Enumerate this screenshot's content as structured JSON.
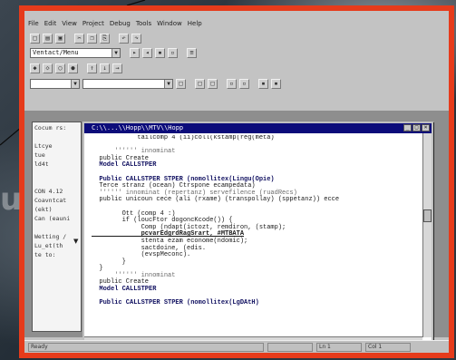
{
  "menu": [
    "File",
    "Edit",
    "View",
    "Project",
    "Debug",
    "Tools",
    "Window",
    "Help"
  ],
  "toolbar_rows": [
    [
      "□",
      "▤",
      "▣",
      "│",
      "✂",
      "❐",
      "⎘",
      "│",
      "↶",
      "↷"
    ],
    [
      "▸",
      "◂",
      "▪",
      "▫",
      "│",
      "≡"
    ],
    [
      "◆",
      "◇",
      "○",
      "●",
      "│",
      "↑",
      "↓",
      "→"
    ],
    [
      "□",
      "│",
      "□",
      "□",
      "│",
      "▫",
      "▫",
      "│",
      "▪",
      "▪"
    ]
  ],
  "combo_value": "Ventact/Menu",
  "editor": {
    "title": "C:\\\\...\\\\Hopp\\\\MTV\\\\Hopp",
    "lines": [
      {
        "t": "            tailcomp 4 (ii)coll(kstamp(reg(meta)",
        "s": ""
      },
      {
        "t": "",
        "s": ""
      },
      {
        "t": "      '''''' innominat",
        "s": "c"
      },
      {
        "t": "  public Create",
        "s": ""
      },
      {
        "t": "  Model CALLSTPER",
        "s": "k"
      },
      {
        "t": "",
        "s": ""
      },
      {
        "t": "  Public CALLSTPER STPER (nomollitex(Lingu(Opie)",
        "s": "k"
      },
      {
        "t": "  Terce stranz (ocean) Ctrspone ecampedata)",
        "s": ""
      },
      {
        "t": "  '''''' innominat (repertanz) servefilence (ruadRecs)",
        "s": "c"
      },
      {
        "t": "  public unicoun cece (ali (rxame) (transpollay) (sppetanz)) ecce",
        "s": ""
      },
      {
        "t": "",
        "s": ""
      },
      {
        "t": "        Ott (comp 4 :)",
        "s": ""
      },
      {
        "t": "        if (loucFtor dogoncKcode()) {",
        "s": ""
      },
      {
        "t": "             Comp (ndapt(ictozt, remdiron, (stamp);",
        "s": ""
      },
      {
        "t": "             pcvarEdgrdRagSrart, #MTBATA",
        "s": "u"
      },
      {
        "t": "             stenta ezam econome(ndomic);",
        "s": ""
      },
      {
        "t": "             sactdoine, (edis.",
        "s": ""
      },
      {
        "t": "             (evspMeconc).",
        "s": ""
      },
      {
        "t": "        }",
        "s": ""
      },
      {
        "t": "  }",
        "s": ""
      },
      {
        "t": "      '''''' innominat",
        "s": "c"
      },
      {
        "t": "  public Create",
        "s": ""
      },
      {
        "t": "  Model CALLSTPER",
        "s": "k"
      },
      {
        "t": "",
        "s": ""
      },
      {
        "t": "  Public CALLSTPER STPER (nomollitex(LgDAtH)",
        "s": "k"
      }
    ]
  },
  "left_panel_lines": [
    "Cocum rs:",
    "",
    "  Ltcye",
    "  tue   ",
    "  ld4t",
    "",
    "",
    "CON 4.12",
    "Coavntcat",
    "(ekt)",
    "Can (eauni",
    "",
    "Wetting /",
    "Lu_et(th",
    "te to:"
  ],
  "status": [
    "Ready",
    "",
    "Ln 1",
    "Col 1"
  ],
  "watermark": "u"
}
